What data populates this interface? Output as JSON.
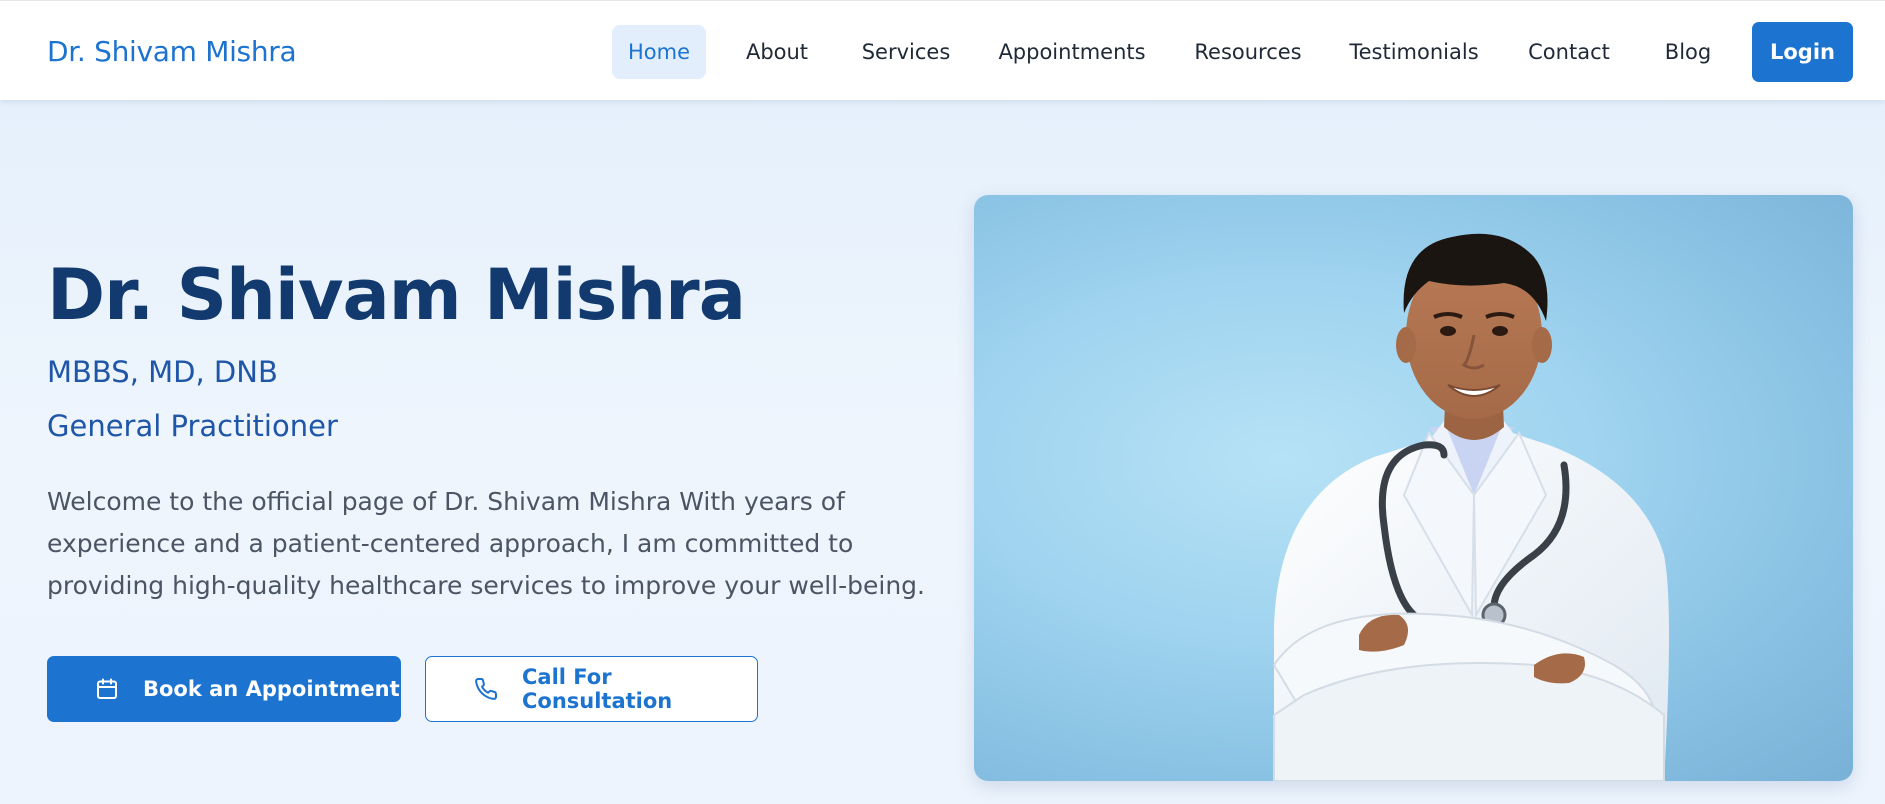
{
  "header": {
    "brand": "Dr. Shivam Mishra",
    "nav": [
      {
        "label": "Home",
        "active": true
      },
      {
        "label": "About",
        "active": false
      },
      {
        "label": "Services",
        "active": false
      },
      {
        "label": "Appointments",
        "active": false
      },
      {
        "label": "Resources",
        "active": false
      },
      {
        "label": "Testimonials",
        "active": false
      },
      {
        "label": "Contact",
        "active": false
      },
      {
        "label": "Blog",
        "active": false
      }
    ],
    "login_label": "Login"
  },
  "hero": {
    "name": "Dr. Shivam Mishra",
    "qualifications": "MBBS, MD, DNB",
    "specialty": "General Practitioner",
    "description": "Welcome to the official page of Dr. Shivam Mishra With years of experience and a patient-centered approach, I am committed to providing high-quality healthcare services to improve your well-being.",
    "primary_button": {
      "label": "Book an Appointment",
      "icon": "calendar-icon"
    },
    "secondary_button": {
      "label": "Call For Consultation",
      "icon": "phone-icon"
    }
  },
  "photo": {
    "subject": "doctor-portrait"
  },
  "colors": {
    "brand_blue": "#1d74d0",
    "heading_navy": "#123a6e",
    "subheading_blue": "#1f56a8",
    "nav_active_bg": "#e2eefb",
    "photo_bg": "#9fd3ef"
  }
}
